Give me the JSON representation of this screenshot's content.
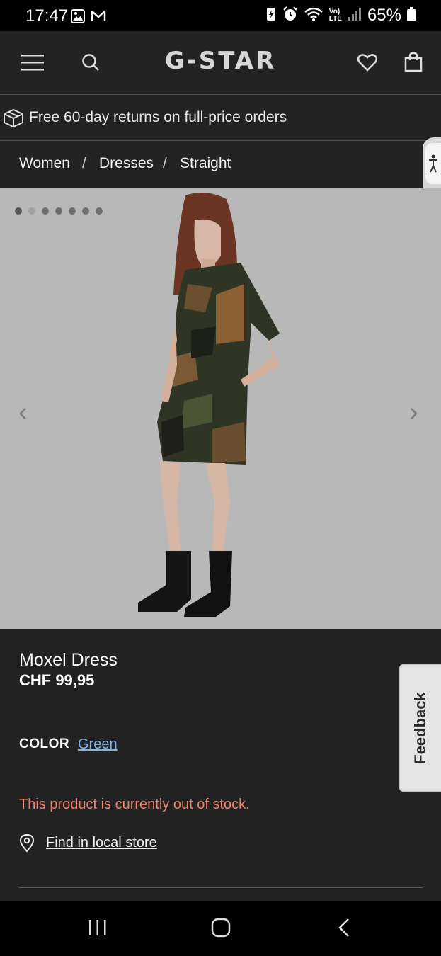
{
  "status_bar": {
    "time": "17:47",
    "battery": "65%",
    "icons": [
      "gallery-icon",
      "gmail-icon",
      "battery-saver-icon",
      "alarm-icon",
      "wifi-icon",
      "volte-icon",
      "signal-icon",
      "battery-icon"
    ]
  },
  "header": {
    "logo": "G-STAR",
    "icons": [
      "menu-icon",
      "search-icon",
      "heart-icon",
      "shopping-bag-icon"
    ]
  },
  "promo": {
    "text": "Free 60-day returns on full-price orders",
    "icon": "box-icon"
  },
  "breadcrumb": {
    "items": [
      "Women",
      "Dresses",
      "Straight"
    ],
    "separator": "/"
  },
  "gallery": {
    "image_count": 7,
    "active_index": 0,
    "prev_label": "‹",
    "next_label": "›"
  },
  "product": {
    "name": "Moxel Dress",
    "price": "CHF 99,95",
    "color_label": "COLOR",
    "color_value": "Green",
    "stock_message": "This product is currently out of stock.",
    "store_link": "Find in local store"
  },
  "feedback": {
    "label": "Feedback"
  },
  "colors": {
    "background": "#222223",
    "out_of_stock": "#f0826d",
    "link": "#7fb3ea"
  }
}
